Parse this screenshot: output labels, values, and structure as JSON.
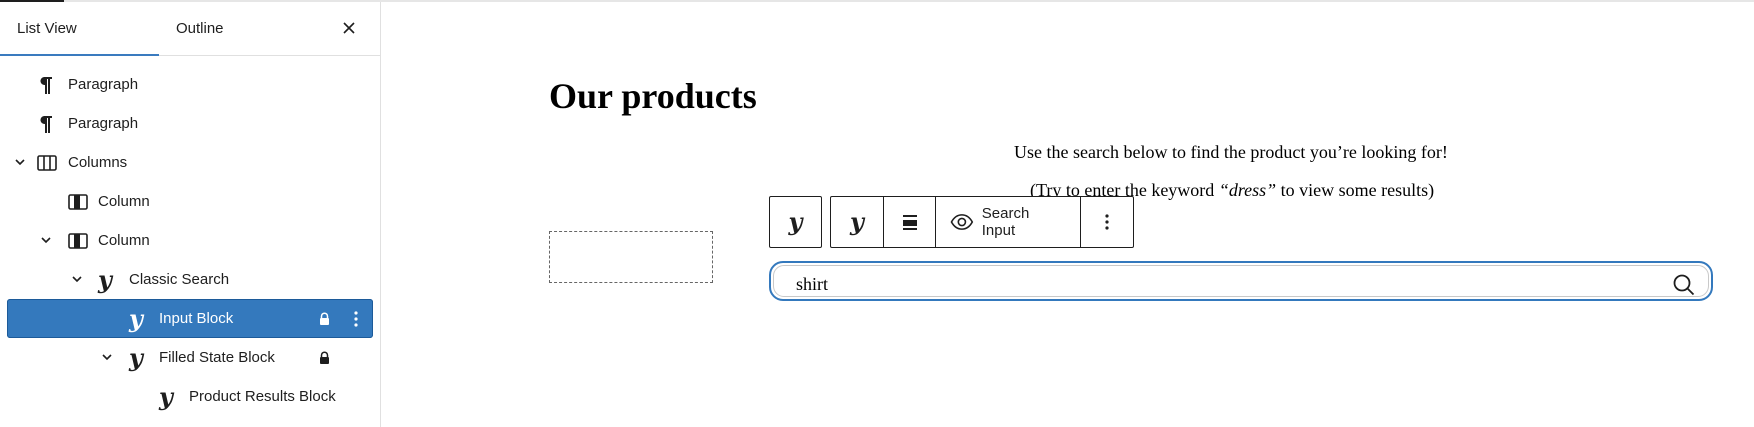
{
  "tabs": {
    "list_view": "List View",
    "outline": "Outline"
  },
  "tree": {
    "paragraph_1": "Paragraph",
    "paragraph_2": "Paragraph",
    "columns": "Columns",
    "column_1": "Column",
    "column_2": "Column",
    "classic_search": "Classic Search",
    "input_block": "Input Block",
    "filled_state_block": "Filled State Block",
    "product_results_block": "Product Results Block"
  },
  "canvas": {
    "heading": "Our products",
    "intro": "Use the search below to find the product you’re looking for!",
    "hint_before": "(Try to enter the keyword ",
    "hint_keyword": "“dress”",
    "hint_after": " to view some results)"
  },
  "toolbar": {
    "block_glyph": "y",
    "parent_glyph": "y",
    "search_input_label": "Search Input",
    "icons": [
      "block-type-icon",
      "parent-block-icon",
      "align-icon",
      "eye-icon",
      "more-options-icon"
    ]
  },
  "search": {
    "value": "shirt"
  },
  "colors": {
    "accent": "#3479bd",
    "text": "#1e1e1e"
  }
}
